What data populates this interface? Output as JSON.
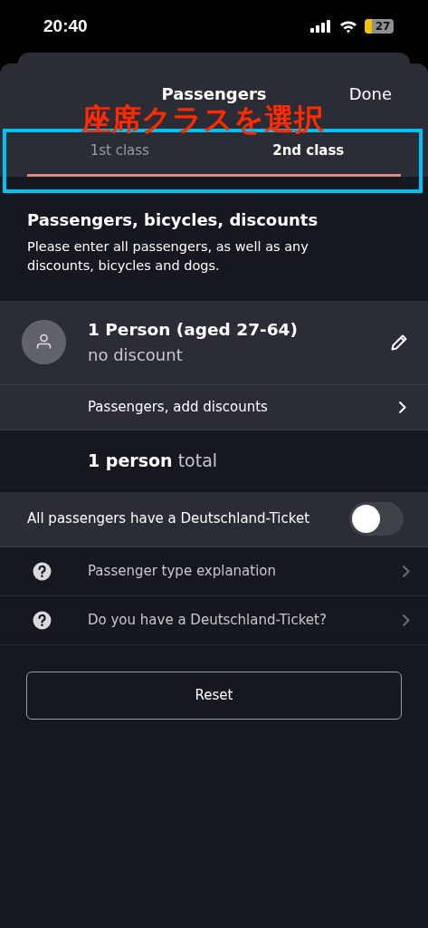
{
  "status_bar": {
    "time": "20:40",
    "battery": "27"
  },
  "sheet": {
    "title": "Passengers",
    "done": "Done"
  },
  "tabs": [
    {
      "label": "1st class",
      "selected": false
    },
    {
      "label": "2nd class",
      "selected": true
    }
  ],
  "annotation": {
    "label": "座席クラスを選択"
  },
  "section": {
    "title": "Passengers, bicycles, discounts",
    "description": "Please enter all passengers, as well as any discounts, bicycles and dogs."
  },
  "passenger": {
    "name": "1 Person (aged 27-64)",
    "discount": "no discount"
  },
  "add_discounts": "Passengers, add discounts",
  "total": "**1 person** total",
  "deutschland_toggle": {
    "label": "All passengers have a Deutschland-Ticket",
    "on": false
  },
  "help_items": [
    {
      "label": "Passenger type explanation"
    },
    {
      "label": "Do you have a Deutschland-Ticket?"
    }
  ],
  "reset": "Reset"
}
